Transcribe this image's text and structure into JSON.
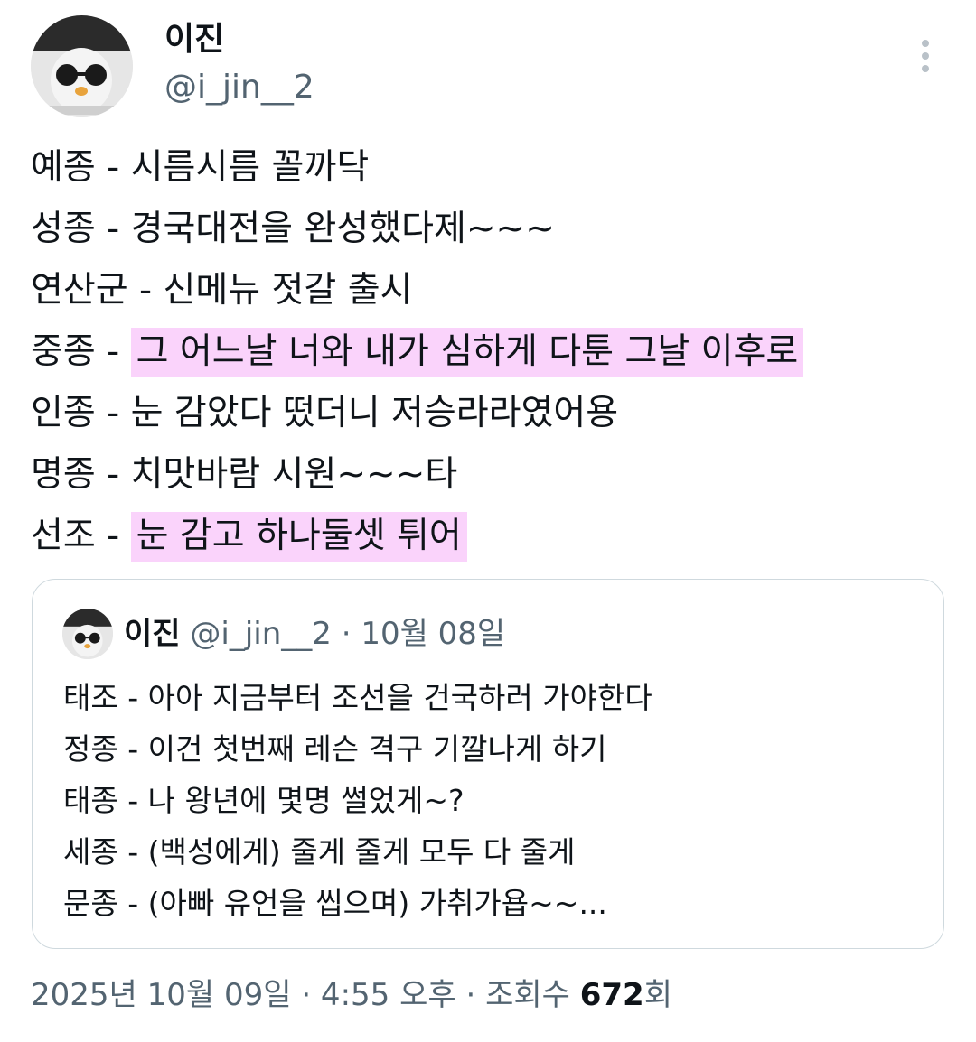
{
  "author": {
    "display_name": "이진",
    "handle": "@i_jin__2"
  },
  "tweet": {
    "lines": [
      {
        "prefix": "예종 - ",
        "highlight": "",
        "text": "시름시름 꼴까닥"
      },
      {
        "prefix": "성종 - ",
        "highlight": "",
        "text": "경국대전을 완성했다제~~~"
      },
      {
        "prefix": "연산군 - ",
        "highlight": "",
        "text": "신메뉴 젓갈 출시"
      },
      {
        "prefix": "중종 - ",
        "highlight": "그 어느날 너와 내가 심하게 다툰 그날 이후로",
        "text": ""
      },
      {
        "prefix": "인종 - ",
        "highlight": "",
        "text": "눈 감았다 떴더니 저승라라였어용"
      },
      {
        "prefix": "명종 - ",
        "highlight": "",
        "text": "치맛바람 시원~~~타"
      },
      {
        "prefix": "선조 - ",
        "highlight": "눈 감고 하나둘셋 튀어",
        "text": ""
      }
    ],
    "highlight_color": "#fad3fb"
  },
  "quote": {
    "display_name": "이진",
    "meta": "@i_jin__2 · 10월 08일",
    "lines": [
      "태조 - 아아 지금부터 조선을 건국하러 가야한다",
      "정종 - 이건 첫번째 레슨 격구 기깔나게 하기",
      "태종 - 나 왕년에 몇명 썰었게~?",
      "세종 - (백성에게) 줄게 줄게 모두 다 줄게",
      "문종 - (아빠 유언을 씹으며) 가취가욥~~..."
    ]
  },
  "footer": {
    "timestamp": "2025년 10월 09일 · 4:55 오후 · 조회수 ",
    "views_count": "672",
    "views_suffix": "회"
  },
  "icons": {
    "more": "more-vertical-icon",
    "avatar": "avatar-image"
  },
  "colors": {
    "text": "#0f1419",
    "secondary": "#536471",
    "border": "#cfd9de"
  }
}
